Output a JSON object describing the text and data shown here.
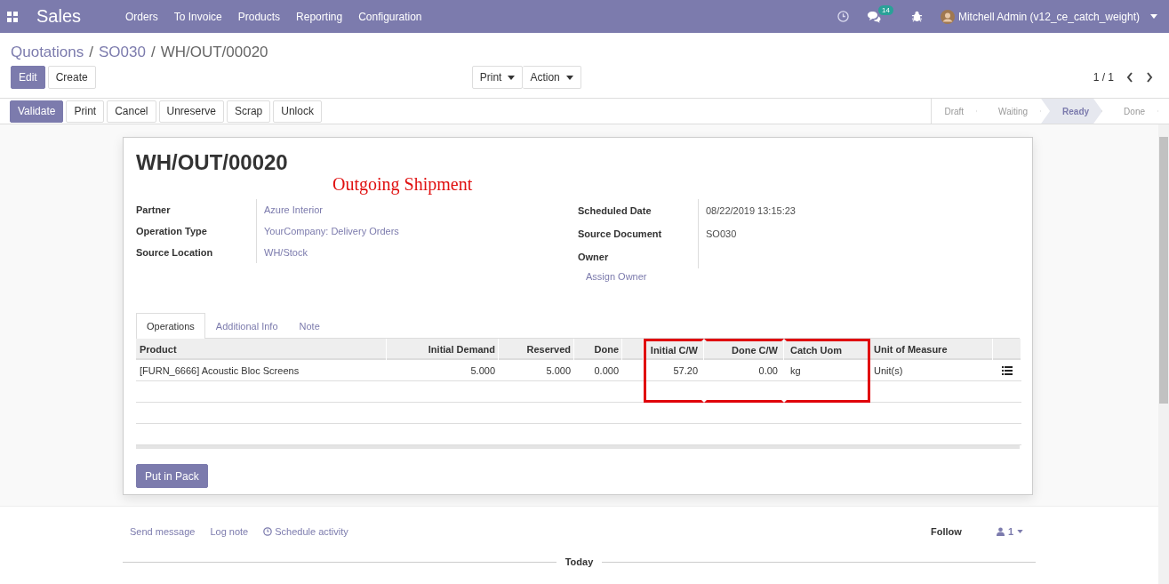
{
  "navbar": {
    "app_name": "Sales",
    "menu": [
      "Orders",
      "To Invoice",
      "Products",
      "Reporting",
      "Configuration"
    ],
    "message_count": "14",
    "user": "Mitchell Admin (v12_ce_catch_weight)"
  },
  "breadcrumbs": [
    {
      "label": "Quotations",
      "kind": "link"
    },
    {
      "label": "/",
      "kind": "separator"
    },
    {
      "label": "SO030",
      "kind": "link"
    },
    {
      "label": "/",
      "kind": "separator"
    },
    {
      "label": "WH/OUT/00020",
      "kind": "current"
    }
  ],
  "control_buttons": [
    {
      "label": "Edit",
      "primary": true
    },
    {
      "label": "Create",
      "primary": false
    }
  ],
  "dropdowns": [
    "Print",
    "Action"
  ],
  "pager": "1 / 1",
  "action_buttons": [
    {
      "label": "Validate",
      "primary": true
    },
    {
      "label": "Print",
      "primary": false
    },
    {
      "label": "Cancel",
      "primary": false
    },
    {
      "label": "Unreserve",
      "primary": false
    },
    {
      "label": "Scrap",
      "primary": false
    },
    {
      "label": "Unlock",
      "primary": false
    }
  ],
  "stages": [
    {
      "label": "Draft",
      "selected": false
    },
    {
      "label": "Waiting",
      "selected": false
    },
    {
      "label": "Ready",
      "selected": true
    },
    {
      "label": "Done",
      "selected": false
    }
  ],
  "record": {
    "title": "WH/OUT/00020",
    "annotation": "Outgoing Shipment",
    "left_fields": [
      {
        "label": "Partner",
        "value": "Azure Interior"
      },
      {
        "label": "Operation Type",
        "value": "YourCompany: Delivery Orders"
      },
      {
        "label": "Source Location",
        "value": "WH/Stock"
      }
    ],
    "right_fields": [
      {
        "label": "Scheduled Date",
        "value": "08/22/2019 13:15:23",
        "kind": "text"
      },
      {
        "label": "Source Document",
        "value": "SO030",
        "kind": "text"
      },
      {
        "label": "Owner",
        "value": "Assign Owner",
        "kind": "link"
      }
    ]
  },
  "tabs": [
    {
      "label": "Operations",
      "selected": true
    },
    {
      "label": "Additional Info",
      "selected": false
    },
    {
      "label": "Note",
      "selected": false
    }
  ],
  "table": {
    "columns": [
      {
        "label": "Product",
        "kind": "text",
        "highlighted": false
      },
      {
        "label": "Initial Demand",
        "kind": "number",
        "highlighted": false
      },
      {
        "label": "Reserved",
        "kind": "number",
        "highlighted": false
      },
      {
        "label": "Done",
        "kind": "number",
        "highlighted": false
      },
      {
        "label": "Initial C/W",
        "kind": "number",
        "highlighted": true
      },
      {
        "label": "Done C/W",
        "kind": "number",
        "highlighted": true
      },
      {
        "label": "Catch Uom",
        "kind": "text",
        "highlighted": true
      },
      {
        "label": "Unit of Measure",
        "kind": "text",
        "highlighted": false
      }
    ],
    "rows": [
      {
        "cells": [
          "[FURN_6666] Acoustic Bloc Screens",
          "5.000",
          "5.000",
          "0.000",
          "57.20",
          "0.00",
          "kg",
          "Unit(s)"
        ]
      }
    ]
  },
  "pack_button": "Put in Pack",
  "chatter": {
    "actions": [
      {
        "label": "Send message",
        "kind": "plain"
      },
      {
        "label": "Log note",
        "kind": "plain"
      },
      {
        "label": "Schedule activity",
        "kind": "clock"
      }
    ],
    "follow": "Follow",
    "followers": "1",
    "separator": "Today"
  }
}
